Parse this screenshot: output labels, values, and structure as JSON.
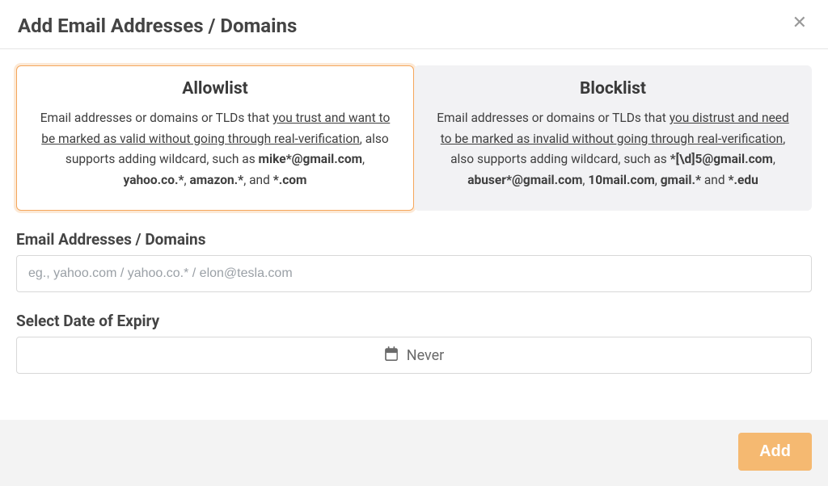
{
  "header": {
    "title": "Add Email Addresses / Domains"
  },
  "cards": {
    "allowlist": {
      "title": "Allowlist",
      "lead": "Email addresses or domains or TLDs that ",
      "underline": "you trust and want to be marked as valid without going through real-verification",
      "tail": ", also supports adding wildcard, such as ",
      "ex1": "mike*@gmail.com",
      "sep1": ", ",
      "ex2": "yahoo.co.*",
      "sep2": ", ",
      "ex3": "amazon.*",
      "sep3": ", and ",
      "ex4": "*.com"
    },
    "blocklist": {
      "title": "Blocklist",
      "lead": "Email addresses or domains or TLDs that ",
      "underline": "you distrust and need to be marked as invalid without going through real-verification",
      "tail": ", also supports adding wildcard, such as ",
      "ex1": "*[\\d]5@gmail.com",
      "sep1": ", ",
      "ex2": "abuser*@gmail.com",
      "sep2": ", ",
      "ex3": "10mail.com",
      "sep3": ", ",
      "ex4": "gmail.*",
      "sep4": " and ",
      "ex5": "*.edu"
    }
  },
  "fields": {
    "emails_label": "Email Addresses / Domains",
    "emails_placeholder": "eg., yahoo.com / yahoo.co.* / elon@tesla.com",
    "expiry_label": "Select Date of Expiry",
    "expiry_value": "Never"
  },
  "footer": {
    "add_label": "Add"
  }
}
